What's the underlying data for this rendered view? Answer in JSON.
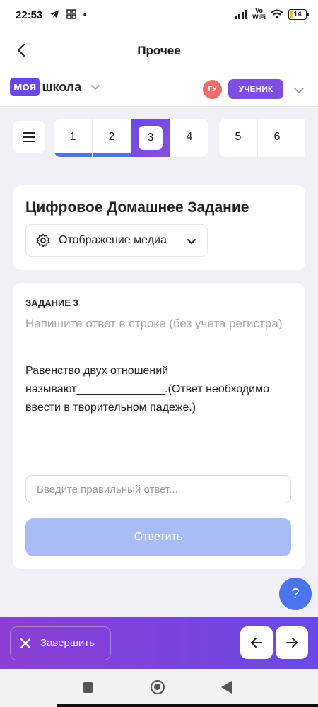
{
  "status_bar": {
    "time": "22:53",
    "battery": "14",
    "network": "Vo\nWiFi",
    "left_icons": "telegram-icon grid-icon dot"
  },
  "header": {
    "title": "Прочее"
  },
  "brand": {
    "logo_box": "моя",
    "logo_text": "школа"
  },
  "user": {
    "initials": "ГУ",
    "role": "УЧЕНИК"
  },
  "tabs": {
    "group1": [
      "1",
      "2",
      "3",
      "4"
    ],
    "group2": [
      "5",
      "6"
    ],
    "active": "3",
    "completed": [
      "1",
      "2"
    ]
  },
  "homework": {
    "title": "Цифровое Домашнее Задание",
    "media_label": "Отображение медиа"
  },
  "task": {
    "label": "ЗАДАНИЕ 3",
    "hint": "Напишите ответ в строке (без учета регистра)",
    "question": "Равенство двух отношений называют______________.(Ответ необходимо ввести в творительном падеже.)",
    "input_placeholder": "Введите правильный ответ...",
    "submit_label": "Ответить"
  },
  "help": {
    "label": "?"
  },
  "footer": {
    "finish_label": "Завершить"
  },
  "colors": {
    "brand": "#6a48e8",
    "accent_blue": "#4b74ef",
    "submit_disabled": "#a9bdf5",
    "avatar": "#f06a6a"
  }
}
